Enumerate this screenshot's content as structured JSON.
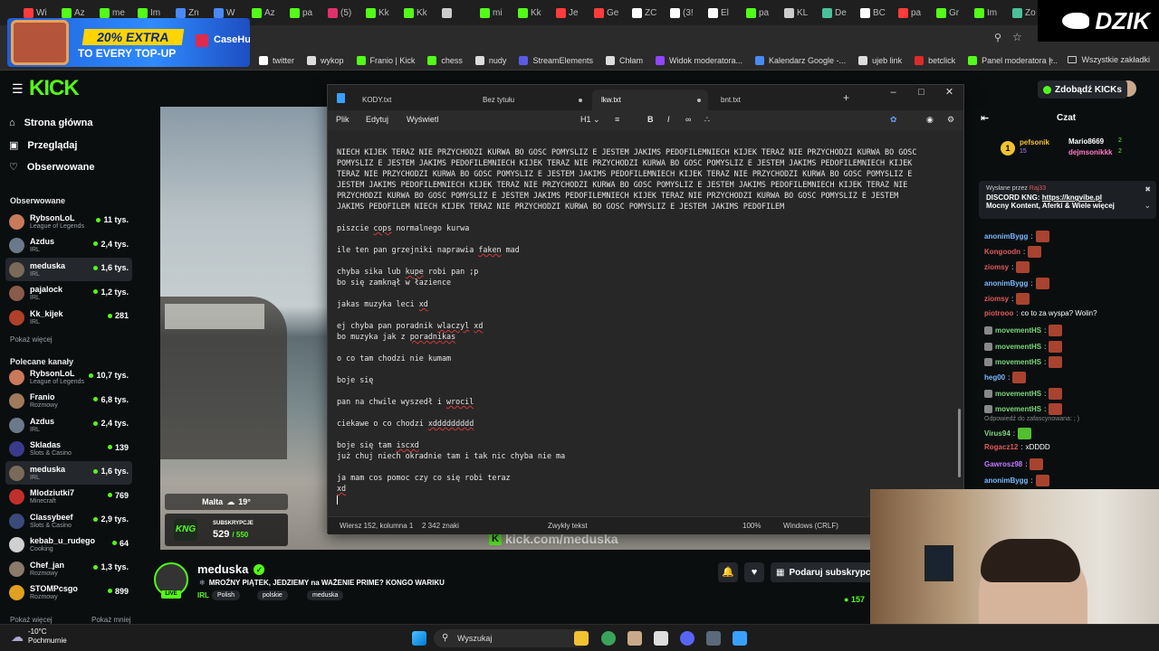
{
  "browser": {
    "tabs": [
      {
        "label": "Wi",
        "icon": "youtube-icon",
        "color": "#ff3b3b"
      },
      {
        "label": "Az",
        "icon": "kick-icon",
        "color": "#53fc18"
      },
      {
        "label": "me",
        "icon": "kick-icon",
        "color": "#53fc18"
      },
      {
        "label": "Im",
        "icon": "kick-icon",
        "color": "#53fc18"
      },
      {
        "label": "Zn",
        "icon": "translate-icon",
        "color": "#4a8af4"
      },
      {
        "label": "W",
        "icon": "globe-icon",
        "color": "#4a8af4"
      },
      {
        "label": "Az",
        "icon": "kick-icon",
        "color": "#53fc18"
      },
      {
        "label": "pa",
        "icon": "kick-icon",
        "color": "#53fc18"
      },
      {
        "label": "(5)",
        "icon": "instagram-icon",
        "color": "#e1306c"
      },
      {
        "label": "Kk",
        "icon": "kick-icon",
        "color": "#53fc18"
      },
      {
        "label": "Kk",
        "icon": "kick-icon",
        "color": "#53fc18"
      },
      {
        "label": "",
        "icon": "audio-icon",
        "color": "#cccccc"
      },
      {
        "label": "mi",
        "icon": "kick-icon",
        "color": "#53fc18"
      },
      {
        "label": "Kk",
        "icon": "kick-icon",
        "color": "#53fc18"
      },
      {
        "label": "Je",
        "icon": "youtube-icon",
        "color": "#ff3b3b"
      },
      {
        "label": "Ge",
        "icon": "youtube-icon",
        "color": "#ff3b3b"
      },
      {
        "label": "ZC",
        "icon": "tiktok-icon",
        "color": "#ffffff"
      },
      {
        "label": "(3!",
        "icon": "tiktok-icon",
        "color": "#ffffff"
      },
      {
        "label": "El",
        "icon": "x-icon",
        "color": "#ffffff"
      },
      {
        "label": "pa",
        "icon": "kick-icon",
        "color": "#53fc18"
      },
      {
        "label": "KL",
        "icon": "chrome-icon",
        "color": "#cccccc"
      },
      {
        "label": "De",
        "icon": "page-icon",
        "color": "#4ac09a"
      },
      {
        "label": "BC",
        "icon": "x-icon",
        "color": "#ffffff"
      },
      {
        "label": "pa",
        "icon": "youtube-icon",
        "color": "#ff3b3b"
      },
      {
        "label": "Gr",
        "icon": "kick-icon",
        "color": "#53fc18"
      },
      {
        "label": "Im",
        "icon": "kick-icon",
        "color": "#53fc18"
      },
      {
        "label": "Zo",
        "icon": "page-icon",
        "color": "#4ac09a"
      }
    ],
    "bookmarks": [
      {
        "label": "twitter",
        "icon": "x-icon",
        "color": "#ffffff"
      },
      {
        "label": "wykop",
        "icon": "wykop-icon",
        "color": "#dddddd"
      },
      {
        "label": "Franio | Kick",
        "icon": "kick-icon",
        "color": "#53fc18"
      },
      {
        "label": "chess",
        "icon": "kick-icon",
        "color": "#53fc18"
      },
      {
        "label": "nudy",
        "icon": "folder-icon",
        "color": "#dddddd"
      },
      {
        "label": "StreamElements",
        "icon": "streamelements-icon",
        "color": "#5a5ae6"
      },
      {
        "label": "Chłam",
        "icon": "globe-icon",
        "color": "#dddddd"
      },
      {
        "label": "Widok moderatora...",
        "icon": "twitch-icon",
        "color": "#9146ff"
      },
      {
        "label": "Kalendarz Google -...",
        "icon": "calendar-icon",
        "color": "#4a8af4"
      },
      {
        "label": "ujeb link",
        "icon": "globe-icon",
        "color": "#dddddd"
      },
      {
        "label": "betclick",
        "icon": "betclic-icon",
        "color": "#e02a2a"
      },
      {
        "label": "Panel moderatora |...",
        "icon": "kick-icon",
        "color": "#53fc18"
      }
    ],
    "all_bookmarks": "Wszystkie zakładki"
  },
  "ad": {
    "line1": "20% EXTRA",
    "line2": "TO EVERY TOP-UP",
    "brand": "CaseHug"
  },
  "overlay_logo": "DZIK",
  "kick": {
    "logo": "KICK",
    "get_kicks": "Zdobądź KICKs",
    "nav": {
      "home": "Strona główna",
      "browse": "Przeglądaj",
      "following": "Obserwowane"
    },
    "followed_title": "Obserwowane",
    "followed": [
      {
        "name": "RybsonLoL",
        "cat": "League of Legends",
        "viewers": "11 tys.",
        "color": "#c97a5a",
        "active": false
      },
      {
        "name": "Azdus",
        "cat": "IRL",
        "viewers": "2,4 tys.",
        "color": "#6a7a8a",
        "active": false
      },
      {
        "name": "meduska",
        "cat": "IRL",
        "viewers": "1,6 tys.",
        "color": "#7a6a5a",
        "active": true
      },
      {
        "name": "pajalock",
        "cat": "IRL",
        "viewers": "1,2 tys.",
        "color": "#8a5a4a",
        "active": false
      },
      {
        "name": "Kk_kijek",
        "cat": "IRL",
        "viewers": "281",
        "color": "#b0402a",
        "active": false
      }
    ],
    "show_more": "Pokaż więcej",
    "recommended_title": "Polecane kanały",
    "recommended": [
      {
        "name": "RybsonLoL",
        "cat": "League of Legends",
        "viewers": "10,7 tys.",
        "color": "#c97a5a",
        "active": false
      },
      {
        "name": "Franio",
        "cat": "Rozmowy",
        "viewers": "6,8 tys.",
        "color": "#a07a5a",
        "active": false
      },
      {
        "name": "Azdus",
        "cat": "IRL",
        "viewers": "2,4 tys.",
        "color": "#6a7a8a",
        "active": false
      },
      {
        "name": "Skladas",
        "cat": "Slots & Casino",
        "viewers": "139",
        "color": "#3a3a8a",
        "active": false
      },
      {
        "name": "meduska",
        "cat": "IRL",
        "viewers": "1,6 tys.",
        "color": "#7a6a5a",
        "active": true
      },
      {
        "name": "Mlodziutki7",
        "cat": "Minecraft",
        "viewers": "769",
        "color": "#c0302a",
        "active": false
      },
      {
        "name": "Classybeef",
        "cat": "Slots & Casino",
        "viewers": "2,9 tys.",
        "color": "#3a4a7a",
        "active": false
      },
      {
        "name": "kebab_u_rudego",
        "cat": "Cooking",
        "viewers": "64",
        "color": "#d0d0d0",
        "active": false
      },
      {
        "name": "Chef_jan",
        "cat": "Rozmowy",
        "viewers": "1,3 tys.",
        "color": "#8a7a6a",
        "active": false
      },
      {
        "name": "STOMPcsgo",
        "cat": "Rozmowy",
        "viewers": "899",
        "color": "#e0a020",
        "active": false
      }
    ],
    "show_more2": "Pokaż więcej",
    "show_less": "Pokaż mniej"
  },
  "video": {
    "weather": "Malta",
    "temp": "19°",
    "subs_label": "SUBSKRYPCJE",
    "subs_count": "529",
    "subs_goal": "/ 550",
    "kick_url": "kick.com/meduska"
  },
  "notepad": {
    "tabs": [
      {
        "label": "KODY.txt",
        "unsaved": false,
        "active": false
      },
      {
        "label": "Bez tytułu",
        "unsaved": true,
        "active": false
      },
      {
        "label": "lkw.txt",
        "unsaved": true,
        "active": true
      },
      {
        "label": "bnt.txt",
        "unsaved": false,
        "active": false
      }
    ],
    "menu": {
      "file": "Plik",
      "edit": "Edytuj",
      "view": "Wyświetl",
      "heading": "H1"
    },
    "lines": [
      "NIECH KIJEK TERAZ NIE PRZYCHODZI KURWA BO GOSC POMYSLIZ E JESTEM JAKIMS PEDOFILEMNIECH KIJEK TERAZ NIE PRZYCHODZI KURWA BO GOSC",
      "POMYSLIZ E JESTEM JAKIMS PEDOFILEMNIECH KIJEK TERAZ NIE PRZYCHODZI KURWA BO GOSC POMYSLIZ E JESTEM JAKIMS PEDOFILEMNIECH KIJEK",
      "TERAZ NIE PRZYCHODZI KURWA BO GOSC POMYSLIZ E JESTEM JAKIMS PEDOFILEMNIECH KIJEK TERAZ NIE PRZYCHODZI KURWA BO GOSC POMYSLIZ E",
      "JESTEM JAKIMS PEDOFILEMNIECH KIJEK TERAZ NIE PRZYCHODZI KURWA BO GOSC POMYSLIZ E JESTEM JAKIMS PEDOFILEMNIECH KIJEK TERAZ NIE",
      "PRZYCHODZI KURWA BO GOSC POMYSLIZ E JESTEM JAKIMS PEDOFILEMNIECH KIJEK TERAZ NIE PRZYCHODZI KURWA BO GOSC POMYSLIZ E JESTEM",
      "JAKIMS PEDOFILEM NIECH KIJEK TERAZ NIE PRZYCHODZI KURWA BO GOSC POMYSLIZ E JESTEM JAKIMS PEDOFILEM",
      "",
      "piszcie cops normalnego kurwa",
      "",
      "ile ten pan grzejniki naprawia faken mad",
      "",
      "chyba sika lub kupe robi pan ;p",
      "bo się zamknął w łazience",
      "",
      "jakas muzyka leci xd",
      "",
      "ej chyba pan poradnik wlaczyl xd",
      "bo muzyka jak z poradnikas",
      "",
      "o co tam chodzi nie kumam",
      "",
      "boje się",
      "",
      "pan na chwile wyszedł i wrocil",
      "",
      "ciekawe o co chodzi xddddddddd",
      "",
      "boje się tam iscxd",
      "już chuj niech okradnie tam i tak nic chyba nie ma",
      "",
      "ja mam cos pomoc czy co się robi teraz",
      "xd"
    ],
    "status": {
      "position": "Wiersz 152, kolumna 1",
      "chars": "2 342 znaki",
      "format": "Zwykły tekst",
      "zoom": "100%",
      "eol": "Windows (CRLF)"
    }
  },
  "stream": {
    "name": "meduska",
    "live": "LIVE",
    "title": "MROŹNY PIĄTEK, JEDZIEMY na WAŻENIE PRIME? KONGO WARIKU",
    "category": "IRL",
    "tags": [
      "Polish",
      "polskie",
      "meduska"
    ],
    "gift": "Podaruj subskrypcję",
    "viewers": "157"
  },
  "chat": {
    "title": "Czat",
    "top": [
      {
        "rank": "1",
        "user": "pefsonik",
        "count": "15",
        "color": "#f2c230"
      },
      {
        "user": "Mario8669",
        "count": "2",
        "color": "#ffffff"
      },
      {
        "user": "dejmsonikkk",
        "count": "2",
        "color": "#ff7ac8"
      }
    ],
    "pinned": {
      "sent_by": "Wysłane przez",
      "sender": "Raj33",
      "line1_prefix": "DISCORD KNG: ",
      "line1_link": "https://kngvibe.pl",
      "line2": "Mocny Kontent, Aferki & Wiele więcej"
    },
    "messages": [
      {
        "user": "anonimBygg",
        "color": "#7ab8ff",
        "text": "",
        "emote": true
      },
      {
        "user": "Kongoodn",
        "color": "#e05a5a",
        "text": "",
        "emote": true
      },
      {
        "user": "ziomsy",
        "color": "#e05a5a",
        "text": "",
        "emote": true
      },
      {
        "user": "anonimBygg",
        "color": "#7ab8ff",
        "text": "",
        "emote": true
      },
      {
        "user": "ziomsy",
        "color": "#e05a5a",
        "text": "",
        "emote": true
      },
      {
        "user": "piotrooo",
        "color": "#e05a5a",
        "text": "co to za wyspa? Wolin?",
        "emote": false
      },
      {
        "user": "movementHS",
        "color": "#7dd87d",
        "text": "",
        "emote": true
      },
      {
        "user": "movementHS",
        "color": "#7dd87d",
        "text": "",
        "emote": true
      },
      {
        "user": "movementHS",
        "color": "#7dd87d",
        "text": "",
        "emote": true
      },
      {
        "user": "heg00",
        "color": "#7ab8ff",
        "text": "",
        "emote": true
      },
      {
        "user": "movementHS",
        "color": "#7dd87d",
        "text": "",
        "emote": true
      },
      {
        "user": "movementHS",
        "color": "#7dd87d",
        "text": "",
        "emote": true
      },
      {
        "user": "Virus94",
        "color": "#7dd87d",
        "text": "",
        "emote": true
      },
      {
        "user": "Rogacz12",
        "color": "#e05a5a",
        "text": "xDDDD",
        "emote": false
      },
      {
        "user": "Gawrosz98",
        "color": "#c07aff",
        "text": "",
        "emote": true
      },
      {
        "user": "anonimBygg",
        "color": "#7ab8ff",
        "text": "",
        "emote": true
      }
    ],
    "reply_note": "Odpowiedź do zafascynowana: ; )"
  },
  "taskbar": {
    "temp": "-10°C",
    "weather": "Pochmurnie",
    "search": "Wyszukaj"
  }
}
